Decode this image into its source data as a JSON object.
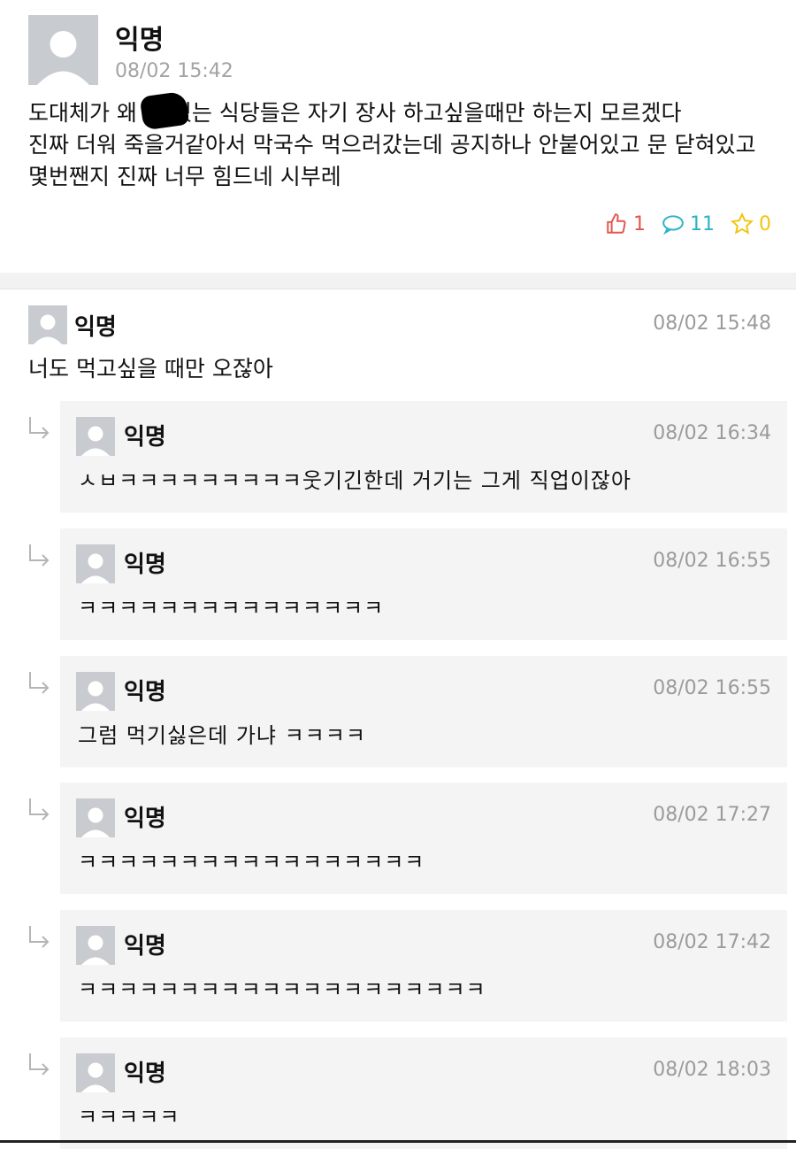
{
  "post": {
    "author": "익명",
    "time": "08/02 15:42",
    "body": [
      "도대체가 왜 에 있는 식당들은 자기 장사 하고싶을때만 하는지 모르겠다",
      "진짜 더워 죽을거같아서 막국수 먹으러갔는데 공지하나 안붙어있고 문 닫혀있고",
      "몇번짼지 진짜 너무 힘드네 시부레"
    ],
    "likes": "1",
    "comments": "11",
    "scraps": "0"
  },
  "comment": {
    "author": "익명",
    "time": "08/02 15:48",
    "text": "너도 먹고싶을 때만 오잖아"
  },
  "replies": [
    {
      "author": "익명",
      "time": "08/02 16:34",
      "text": "ㅅㅂㅋㅋㅋㅋㅋㅋㅋㅋㅋ웃기긴한데 거기는 그게 직업이잖아"
    },
    {
      "author": "익명",
      "time": "08/02 16:55",
      "text": "ㅋㅋㅋㅋㅋㅋㅋㅋㅋㅋㅋㅋㅋㅋㅋ"
    },
    {
      "author": "익명",
      "time": "08/02 16:55",
      "text": "그럼 먹기싫은데 가냐 ㅋㅋㅋㅋ"
    },
    {
      "author": "익명",
      "time": "08/02 17:27",
      "text": "ㅋㅋㅋㅋㅋㅋㅋㅋㅋㅋㅋㅋㅋㅋㅋㅋㅋ"
    },
    {
      "author": "익명",
      "time": "08/02 17:42",
      "text": "ㅋㅋㅋㅋㅋㅋㅋㅋㅋㅋㅋㅋㅋㅋㅋㅋㅋㅋㅋㅋ"
    },
    {
      "author": "익명",
      "time": "08/02 18:03",
      "text": "ㅋㅋㅋㅋㅋ"
    }
  ]
}
